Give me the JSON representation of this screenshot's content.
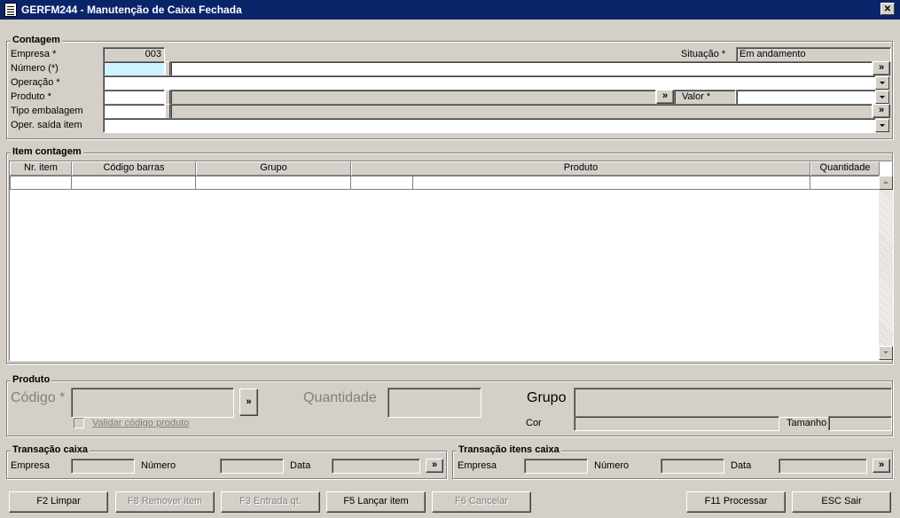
{
  "window": {
    "title": "GERFM244 - Manutenção de Caixa Fechada",
    "close_glyph": "✕"
  },
  "contagem": {
    "title": "Contagem",
    "empresa_label": "Empresa *",
    "empresa_value": "003",
    "situacao_label": "Situação *",
    "situacao_value": "Em andamento",
    "numero_label": "Número (*)",
    "numero_value": "",
    "numero_desc": "",
    "operacao_label": "Operação *",
    "produto_label": "Produto *",
    "valor_label": "Valor *",
    "tipo_embalagem_label": "Tipo embalagem",
    "oper_saida_label": "Oper. saída item"
  },
  "item_contagem": {
    "title": "Item contagem",
    "columns": [
      "Nr. item",
      "Código barras",
      "Grupo",
      "Produto",
      "Quantidade"
    ]
  },
  "produto": {
    "title": "Produto",
    "codigo_label": "Código *",
    "quantidade_label": "Quantidade",
    "grupo_label": "Grupo",
    "validar_label": "Validar código produto",
    "cor_label": "Cor",
    "tamanho_label": "Tamanho"
  },
  "transacao_caixa": {
    "title": "Transação caixa",
    "empresa_label": "Empresa",
    "numero_label": "Número",
    "data_label": "Data"
  },
  "transacao_itens_caixa": {
    "title": "Transação itens caixa",
    "empresa_label": "Empresa",
    "numero_label": "Número",
    "data_label": "Data"
  },
  "buttons": {
    "lookup_glyph": "»",
    "limpar": "F2 Limpar",
    "remover_item": "F8 Remover item",
    "entrada_qt": "F3 Entrada qt.",
    "lancar_item": "F5 Lançar item",
    "cancelar": "F6 Cancelar",
    "processar": "F11 Processar",
    "sair": "ESC Sair"
  },
  "icons": {
    "app": "document-icon",
    "close": "close-icon",
    "lookup": "double-chevron-right-icon",
    "dropdown": "chevron-down-icon"
  }
}
